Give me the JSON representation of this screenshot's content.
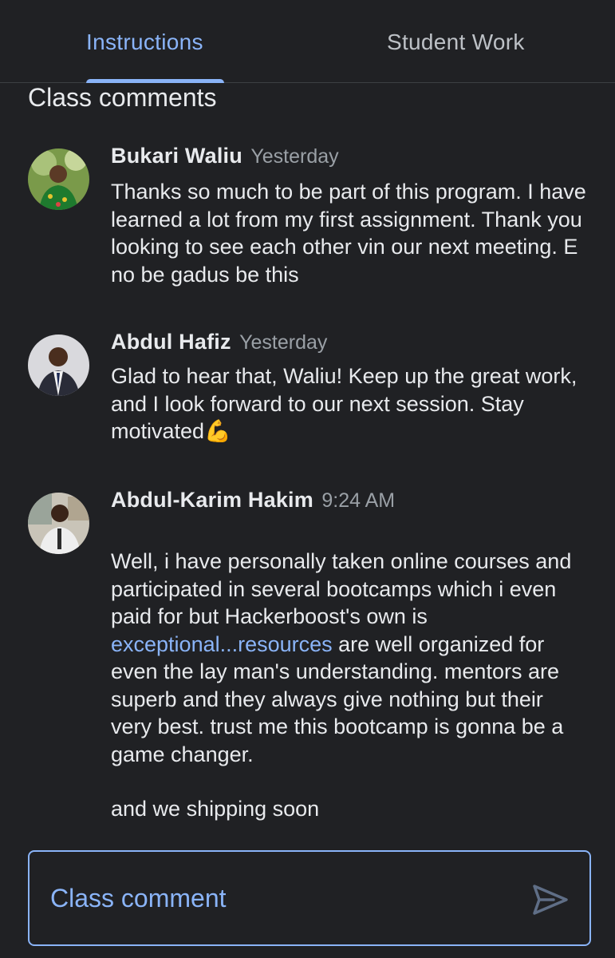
{
  "tabs": {
    "instructions": "Instructions",
    "student_work": "Student Work"
  },
  "section_title": "Class comments",
  "comments": [
    {
      "author": "Bukari Waliu",
      "time": "Yesterday",
      "text": "Thanks so much to be part of this program. I have learned a lot from my first assignment. Thank you looking to see each other vin our next meeting. E no be gadus be this"
    },
    {
      "author": "Abdul Hafiz",
      "time": "Yesterday",
      "text": "Glad to hear that, Waliu! Keep up the great work, and I look forward to our next session. Stay motivated",
      "emoji": "💪"
    },
    {
      "author": "Abdul-Karim Hakim",
      "time": "9:24 AM",
      "text_before_link": "Well, i have personally taken online courses and participated in several bootcamps which i even paid for but Hackerboost's own is ",
      "link_text": "exceptional...resources",
      "text_after_link": " are well organized for even the lay man's understanding. mentors are superb and they always give nothing but their very best. trust me this bootcamp is gonna be a game changer.",
      "closing": "and we shipping soon"
    }
  ],
  "input": {
    "placeholder": "Class comment"
  },
  "colors": {
    "background": "#202124",
    "accent": "#8ab4f8",
    "text": "#e8eaed",
    "muted": "#9aa0a6"
  }
}
